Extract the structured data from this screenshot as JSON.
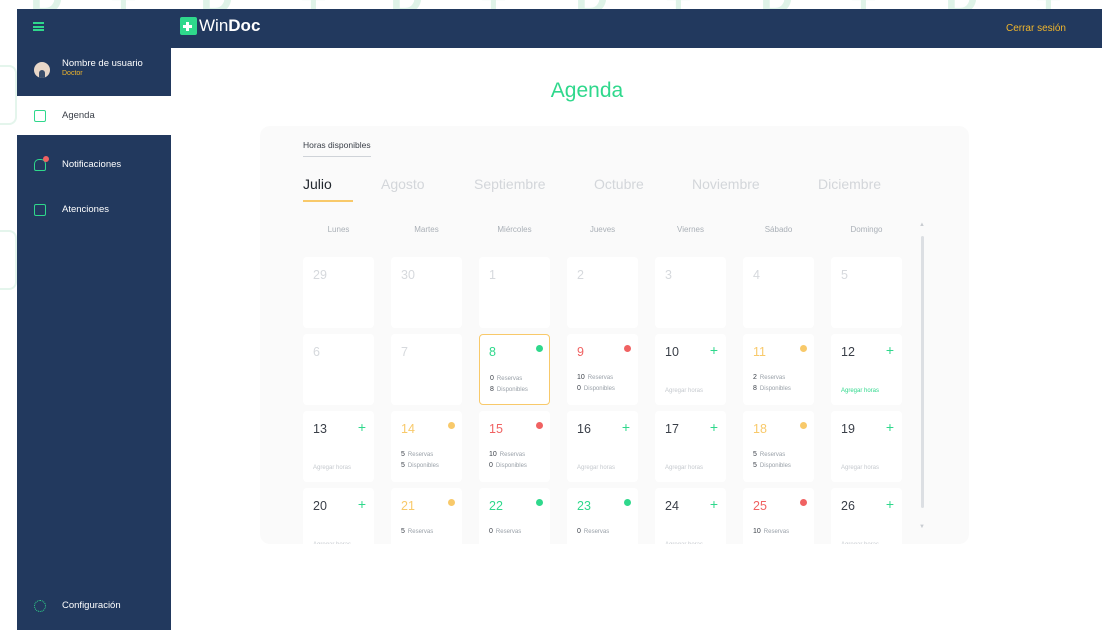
{
  "app": {
    "brand_prefix": "Win",
    "brand_suffix": "Doc",
    "logout_label": "Cerrar sesión"
  },
  "sidebar": {
    "user_name": "Nombre de usuario",
    "user_role": "Doctor",
    "items": [
      {
        "label": "Agenda",
        "icon": "calendar-icon",
        "active": true
      },
      {
        "label": "Notificaciones",
        "icon": "bell-icon",
        "active": false
      },
      {
        "label": "Atenciones",
        "icon": "clipboard-icon",
        "active": false
      }
    ],
    "settings_label": "Configuración"
  },
  "page": {
    "title": "Agenda",
    "section_label": "Horas disponibles",
    "months": [
      "Julio",
      "Agosto",
      "Septiembre",
      "Octubre",
      "Noviembre",
      "Diciembre"
    ],
    "active_month": "Julio",
    "weekdays": [
      "Lunes",
      "Martes",
      "Miércoles",
      "Jueves",
      "Viernes",
      "Sábado",
      "Domingo"
    ],
    "reservas_label": "Reservas",
    "disponibles_label": "Disponibles",
    "add_hours_label": "Agregar horas"
  },
  "colors": {
    "accent_green": "#2fd88c",
    "warning_yellow": "#f8c96a",
    "danger_red": "#f06262",
    "sidebar_bg": "#22395e"
  },
  "calendar": [
    {
      "day": "29",
      "state": "muted"
    },
    {
      "day": "30",
      "state": "muted"
    },
    {
      "day": "1",
      "state": "muted"
    },
    {
      "day": "2",
      "state": "muted"
    },
    {
      "day": "3",
      "state": "muted"
    },
    {
      "day": "4",
      "state": "muted"
    },
    {
      "day": "5",
      "state": "muted"
    },
    {
      "day": "6",
      "state": "muted"
    },
    {
      "day": "7",
      "state": "muted"
    },
    {
      "day": "8",
      "state": "green",
      "reservas": "0",
      "disponibles": "8",
      "selected": true
    },
    {
      "day": "9",
      "state": "red",
      "reservas": "10",
      "disponibles": "0"
    },
    {
      "day": "10",
      "state": "add"
    },
    {
      "day": "11",
      "state": "yellow",
      "reservas": "2",
      "disponibles": "8"
    },
    {
      "day": "12",
      "state": "add",
      "add_highlight": true
    },
    {
      "day": "13",
      "state": "add"
    },
    {
      "day": "14",
      "state": "yellow",
      "reservas": "5",
      "disponibles": "5"
    },
    {
      "day": "15",
      "state": "red",
      "reservas": "10",
      "disponibles": "0"
    },
    {
      "day": "16",
      "state": "add"
    },
    {
      "day": "17",
      "state": "add"
    },
    {
      "day": "18",
      "state": "yellow",
      "reservas": "5",
      "disponibles": "5"
    },
    {
      "day": "19",
      "state": "add"
    },
    {
      "day": "20",
      "state": "add"
    },
    {
      "day": "21",
      "state": "yellow",
      "reservas": "5"
    },
    {
      "day": "22",
      "state": "green",
      "reservas": "0"
    },
    {
      "day": "23",
      "state": "green",
      "reservas": "0"
    },
    {
      "day": "24",
      "state": "add"
    },
    {
      "day": "25",
      "state": "red",
      "reservas": "10"
    },
    {
      "day": "26",
      "state": "add"
    }
  ]
}
